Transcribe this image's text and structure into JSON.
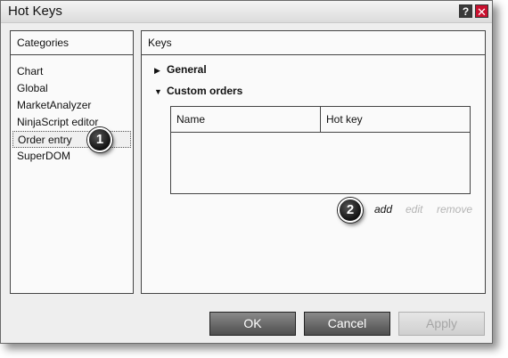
{
  "window": {
    "title": "Hot Keys",
    "help_label": "?",
    "close_label": "✕"
  },
  "categories": {
    "header": "Categories",
    "items": [
      {
        "label": "Chart"
      },
      {
        "label": "Global"
      },
      {
        "label": "MarketAnalyzer"
      },
      {
        "label": "NinjaScript editor"
      },
      {
        "label": "Order entry",
        "selected": true
      },
      {
        "label": "SuperDOM"
      }
    ]
  },
  "keys": {
    "header": "Keys",
    "groups": [
      {
        "label": "General",
        "expanded": false,
        "arrow": "▶"
      },
      {
        "label": "Custom orders",
        "expanded": true,
        "arrow": "▼"
      }
    ],
    "table": {
      "columns": [
        "Name",
        "Hot key"
      ],
      "rows": []
    },
    "actions": {
      "add": "add",
      "edit": "edit",
      "remove": "remove"
    }
  },
  "callouts": [
    "1",
    "2"
  ],
  "buttons": {
    "ok": "OK",
    "cancel": "Cancel",
    "apply": "Apply"
  },
  "colors": {
    "close_red": "#c8102e",
    "disabled_text": "#b4b4b4",
    "button_dark": "#4e4e4e"
  }
}
